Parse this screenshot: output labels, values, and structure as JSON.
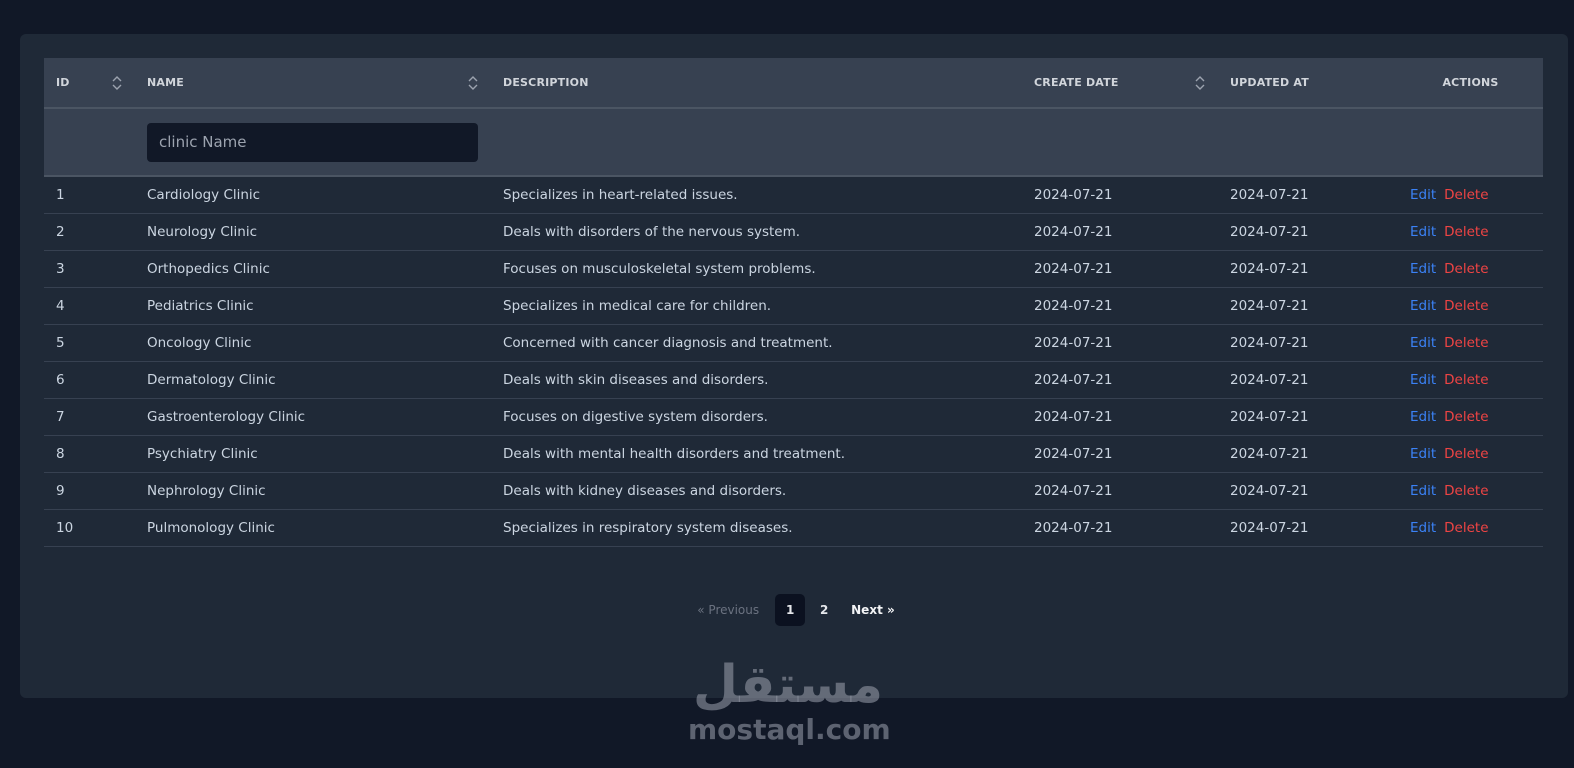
{
  "table": {
    "headers": {
      "id": "ID",
      "name": "NAME",
      "description": "DESCRIPTION",
      "create_date": "CREATE DATE",
      "updated_at": "UPDATED AT",
      "actions": "ACTIONS"
    },
    "filter": {
      "placeholder": "clinic Name",
      "value": ""
    },
    "edit_label": "Edit",
    "delete_label": "Delete",
    "rows": [
      {
        "id": "1",
        "name": "Cardiology Clinic",
        "description": "Specializes in heart-related issues.",
        "create_date": "2024-07-21",
        "updated_at": "2024-07-21"
      },
      {
        "id": "2",
        "name": "Neurology Clinic",
        "description": "Deals with disorders of the nervous system.",
        "create_date": "2024-07-21",
        "updated_at": "2024-07-21"
      },
      {
        "id": "3",
        "name": "Orthopedics Clinic",
        "description": "Focuses on musculoskeletal system problems.",
        "create_date": "2024-07-21",
        "updated_at": "2024-07-21"
      },
      {
        "id": "4",
        "name": "Pediatrics Clinic",
        "description": "Specializes in medical care for children.",
        "create_date": "2024-07-21",
        "updated_at": "2024-07-21"
      },
      {
        "id": "5",
        "name": "Oncology Clinic",
        "description": "Concerned with cancer diagnosis and treatment.",
        "create_date": "2024-07-21",
        "updated_at": "2024-07-21"
      },
      {
        "id": "6",
        "name": "Dermatology Clinic",
        "description": "Deals with skin diseases and disorders.",
        "create_date": "2024-07-21",
        "updated_at": "2024-07-21"
      },
      {
        "id": "7",
        "name": "Gastroenterology Clinic",
        "description": "Focuses on digestive system disorders.",
        "create_date": "2024-07-21",
        "updated_at": "2024-07-21"
      },
      {
        "id": "8",
        "name": "Psychiatry Clinic",
        "description": "Deals with mental health disorders and treatment.",
        "create_date": "2024-07-21",
        "updated_at": "2024-07-21"
      },
      {
        "id": "9",
        "name": "Nephrology Clinic",
        "description": "Deals with kidney diseases and disorders.",
        "create_date": "2024-07-21",
        "updated_at": "2024-07-21"
      },
      {
        "id": "10",
        "name": "Pulmonology Clinic",
        "description": "Specializes in respiratory system diseases.",
        "create_date": "2024-07-21",
        "updated_at": "2024-07-21"
      }
    ]
  },
  "pagination": {
    "previous": "« Previous",
    "pages": [
      "1",
      "2"
    ],
    "current": "1",
    "next": "Next »"
  },
  "watermark": {
    "arabic": "مستقل",
    "latin": "mostaql.com"
  },
  "colors": {
    "background": "#111827",
    "card": "#1f2937",
    "header": "#374151",
    "edit": "#3b82f6",
    "delete": "#ef4444"
  },
  "icons": {
    "sort": "sort-updown-icon"
  }
}
